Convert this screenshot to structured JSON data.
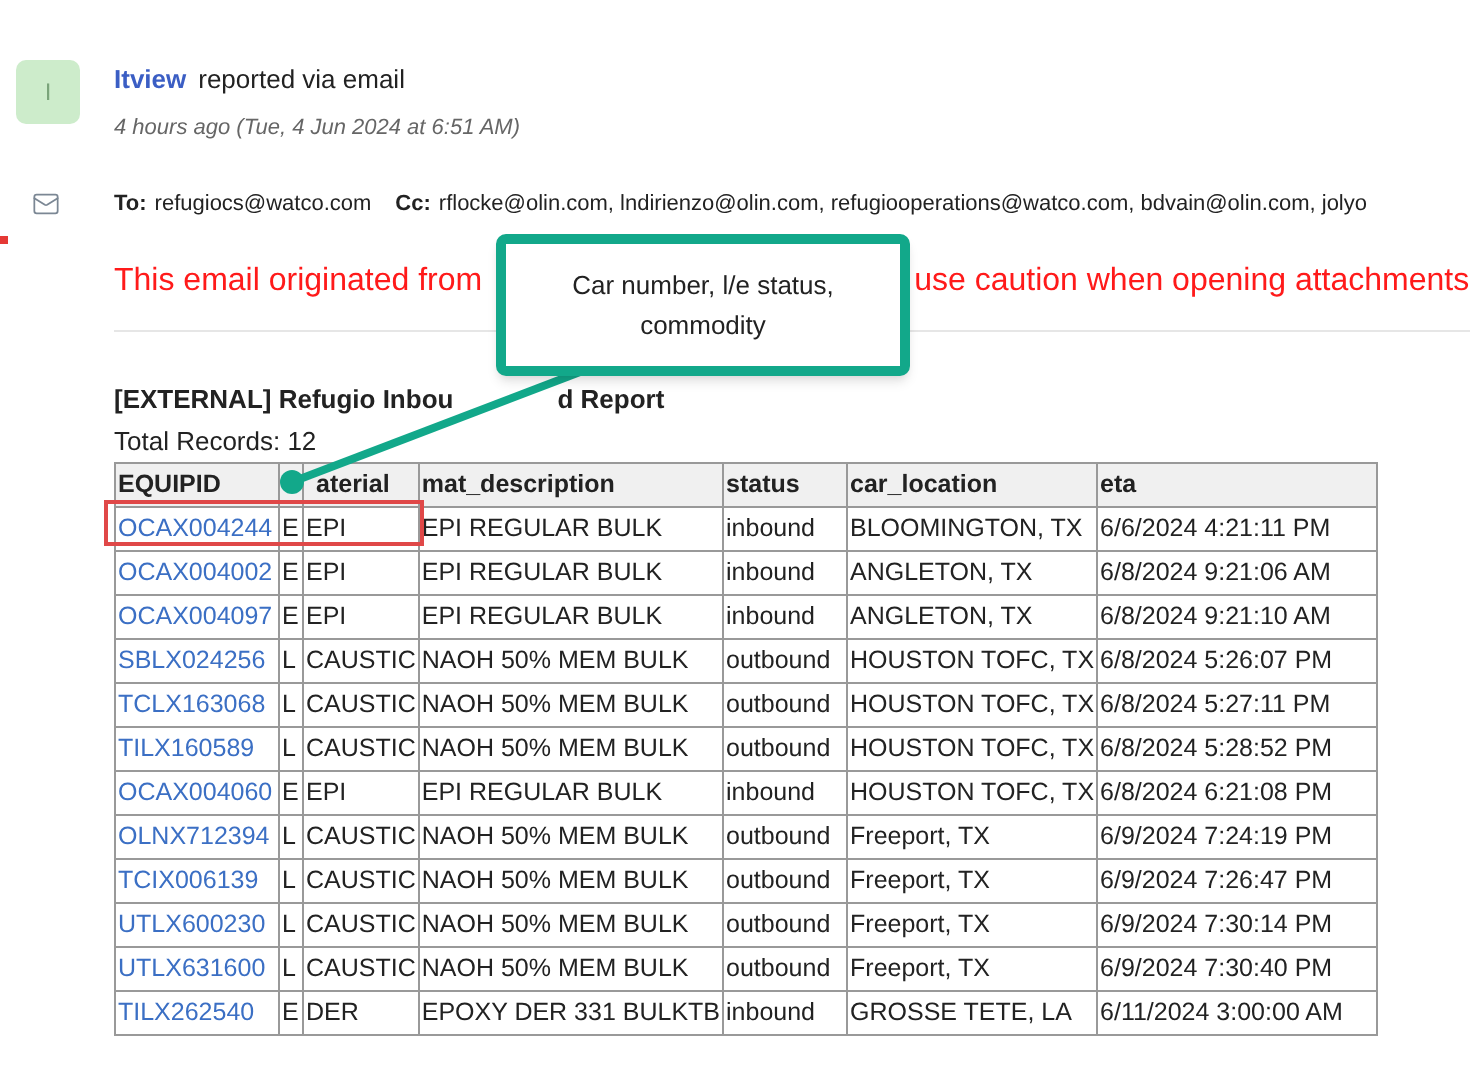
{
  "sender": {
    "avatar_letter": "I",
    "name": "Itview",
    "action": "reported via email",
    "time": "4 hours ago (Tue, 4 Jun 2024 at 6:51 AM)"
  },
  "recipients": {
    "to_label": "To:",
    "to": "refugiocs@watco.com",
    "cc_label": "Cc:",
    "cc": "rflocke@olin.com, lndirienzo@olin.com, refugiooperations@watco.com, bdvain@olin.com, jolyo"
  },
  "warning": [
    "This email originated from",
    "use caution when opening attachments"
  ],
  "report": {
    "title": [
      "[EXTERNAL] Refugio Inbou",
      "d Report"
    ],
    "total": "Total Records: 12",
    "columns": [
      "EQUIPID",
      "",
      "aterial",
      "mat_description",
      "status",
      "car_location",
      "eta"
    ],
    "rows": [
      [
        "OCAX004244",
        "E",
        "EPI",
        "EPI REGULAR BULK",
        "inbound",
        "BLOOMINGTON, TX",
        "6/6/2024 4:21:11 PM"
      ],
      [
        "OCAX004002",
        "E",
        "EPI",
        "EPI REGULAR BULK",
        "inbound",
        "ANGLETON, TX",
        "6/8/2024 9:21:06 AM"
      ],
      [
        "OCAX004097",
        "E",
        "EPI",
        "EPI REGULAR BULK",
        "inbound",
        "ANGLETON, TX",
        "6/8/2024 9:21:10 AM"
      ],
      [
        "SBLX024256",
        "L",
        "CAUSTIC",
        "NAOH 50% MEM BULK",
        "outbound",
        "HOUSTON TOFC, TX",
        "6/8/2024 5:26:07 PM"
      ],
      [
        "TCLX163068",
        "L",
        "CAUSTIC",
        "NAOH 50% MEM BULK",
        "outbound",
        "HOUSTON TOFC, TX",
        "6/8/2024 5:27:11 PM"
      ],
      [
        "TILX160589",
        "L",
        "CAUSTIC",
        "NAOH 50% MEM BULK",
        "outbound",
        "HOUSTON TOFC, TX",
        "6/8/2024 5:28:52 PM"
      ],
      [
        "OCAX004060",
        "E",
        "EPI",
        "EPI REGULAR BULK",
        "inbound",
        "HOUSTON TOFC, TX",
        "6/8/2024 6:21:08 PM"
      ],
      [
        "OLNX712394",
        "L",
        "CAUSTIC",
        "NAOH 50% MEM BULK",
        "outbound",
        "Freeport, TX",
        "6/9/2024 7:24:19 PM"
      ],
      [
        "TCIX006139",
        "L",
        "CAUSTIC",
        "NAOH 50% MEM BULK",
        "outbound",
        "Freeport, TX",
        "6/9/2024 7:26:47 PM"
      ],
      [
        "UTLX600230",
        "L",
        "CAUSTIC",
        "NAOH 50% MEM BULK",
        "outbound",
        "Freeport, TX",
        "6/9/2024 7:30:14 PM"
      ],
      [
        "UTLX631600",
        "L",
        "CAUSTIC",
        "NAOH 50% MEM BULK",
        "outbound",
        "Freeport, TX",
        "6/9/2024 7:30:40 PM"
      ],
      [
        "TILX262540",
        "E",
        "DER",
        "EPOXY DER 331 BULKTB",
        "inbound",
        "GROSSE TETE, LA",
        "6/11/2024 3:00:00 AM"
      ]
    ]
  },
  "callout": {
    "text": "Car number, l/e status, commodity"
  }
}
